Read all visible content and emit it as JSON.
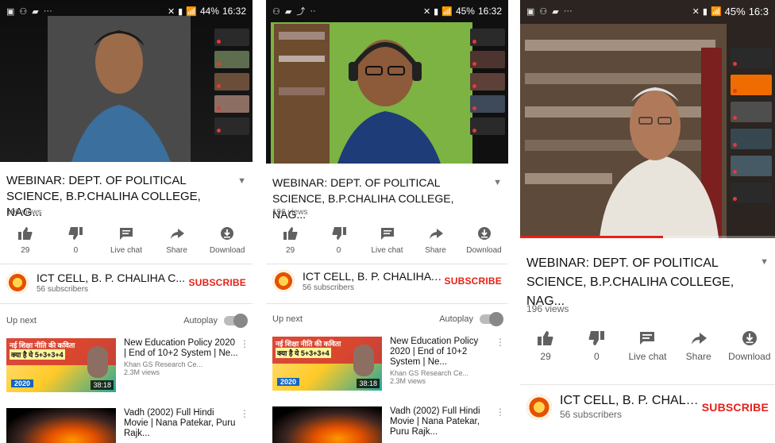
{
  "screens": [
    {
      "status_time": "16:32",
      "battery": "44%",
      "video_title": "WEBINAR: DEPT. OF POLITICAL SCIENCE, B.P.CHALIHA COLLEGE, NAG...",
      "views": "196 views",
      "actions": [
        {
          "icon": "thumbs-up-icon",
          "label": "29"
        },
        {
          "icon": "thumbs-down-icon",
          "label": "0"
        },
        {
          "icon": "live-chat-icon",
          "label": "Live chat"
        },
        {
          "icon": "share-icon",
          "label": "Share"
        },
        {
          "icon": "download-icon",
          "label": "Download"
        }
      ],
      "channel_name": "ICT CELL, B. P. CHALIHA C...",
      "subscribers": "56 subscribers",
      "subscribe_label": "SUBSCRIBE",
      "up_next": "Up next",
      "autoplay": "Autoplay",
      "recommendations": [
        {
          "title": "New Education Policy 2020 | End of 10+2 System | Ne...",
          "channel": "Khan GS Research Ce...",
          "views": "2.3M views",
          "duration": "38:18"
        },
        {
          "title": "Vadh (2002) Full Hindi Movie | Nana Patekar, Puru Rajk...",
          "channel": "",
          "views": "",
          "duration": ""
        }
      ]
    },
    {
      "status_time": "16:32",
      "battery": "45%",
      "video_title": "WEBINAR: DEPT. OF POLITICAL SCIENCE, B.P.CHALIHA COLLEGE, NAG...",
      "views": "196 views",
      "actions": [
        {
          "icon": "thumbs-up-icon",
          "label": "29"
        },
        {
          "icon": "thumbs-down-icon",
          "label": "0"
        },
        {
          "icon": "live-chat-icon",
          "label": "Live chat"
        },
        {
          "icon": "share-icon",
          "label": "Share"
        },
        {
          "icon": "download-icon",
          "label": "Download"
        }
      ],
      "channel_name": "ICT CELL, B. P. CHALIHA C...",
      "subscribers": "56 subscribers",
      "subscribe_label": "SUBSCRIBE",
      "up_next": "Up next",
      "autoplay": "Autoplay",
      "recommendations": [
        {
          "title": "New Education Policy 2020 | End of 10+2 System | Ne...",
          "channel": "Khan GS Research Ce...",
          "views": "2.3M views",
          "duration": "38:18"
        },
        {
          "title": "Vadh (2002) Full Hindi Movie | Nana Patekar, Puru Rajk...",
          "channel": "",
          "views": "",
          "duration": ""
        }
      ]
    },
    {
      "status_time": "16:3",
      "battery": "45%",
      "video_title": "WEBINAR: DEPT. OF POLITICAL SCIENCE, B.P.CHALIHA COLLEGE, NAG...",
      "views": "196 views",
      "actions": [
        {
          "icon": "thumbs-up-icon",
          "label": "29"
        },
        {
          "icon": "thumbs-down-icon",
          "label": "0"
        },
        {
          "icon": "live-chat-icon",
          "label": "Live chat"
        },
        {
          "icon": "share-icon",
          "label": "Share"
        },
        {
          "icon": "download-icon",
          "label": "Download"
        }
      ],
      "channel_name": "ICT CELL, B. P. CHALIHA C...",
      "subscribers": "56 subscribers",
      "subscribe_label": "SUBSCRIBE"
    }
  ],
  "colors": {
    "accent_red": "#e62117",
    "text": "#111111",
    "muted": "#666666"
  }
}
